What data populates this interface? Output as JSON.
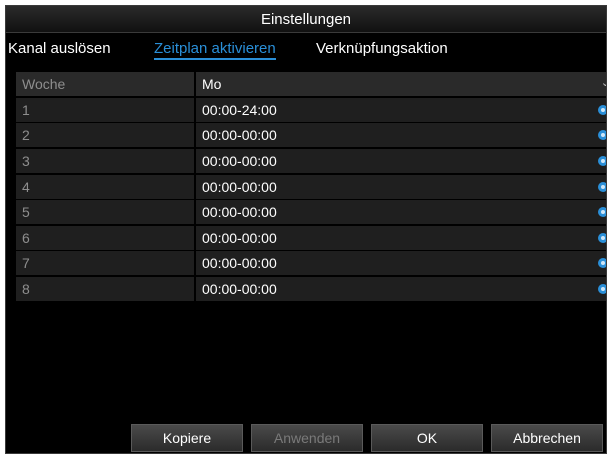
{
  "window": {
    "title": "Einstellungen"
  },
  "tabs": [
    {
      "label": "Kanal auslösen",
      "active": false
    },
    {
      "label": "Zeitplan aktivieren",
      "active": true
    },
    {
      "label": "Verknüpfungsaktion",
      "active": false
    }
  ],
  "schedule": {
    "header": {
      "label": "Woche",
      "value": "Mo"
    },
    "periods": [
      {
        "index": "1",
        "time": "00:00-24:00"
      },
      {
        "index": "2",
        "time": "00:00-00:00"
      },
      {
        "index": "3",
        "time": "00:00-00:00"
      },
      {
        "index": "4",
        "time": "00:00-00:00"
      },
      {
        "index": "5",
        "time": "00:00-00:00"
      },
      {
        "index": "6",
        "time": "00:00-00:00"
      },
      {
        "index": "7",
        "time": "00:00-00:00"
      },
      {
        "index": "8",
        "time": "00:00-00:00"
      }
    ]
  },
  "buttons": {
    "copy": "Kopiere",
    "apply": "Anwenden",
    "ok": "OK",
    "cancel": "Abbrechen"
  },
  "colors": {
    "accent": "#2a8fd8",
    "background": "#000000",
    "row": "#1f1f1f",
    "disabled_text": "#7a7a7a"
  },
  "icons": {
    "period_edit": "gear-icon",
    "dropdown": "chevron-down-icon"
  }
}
